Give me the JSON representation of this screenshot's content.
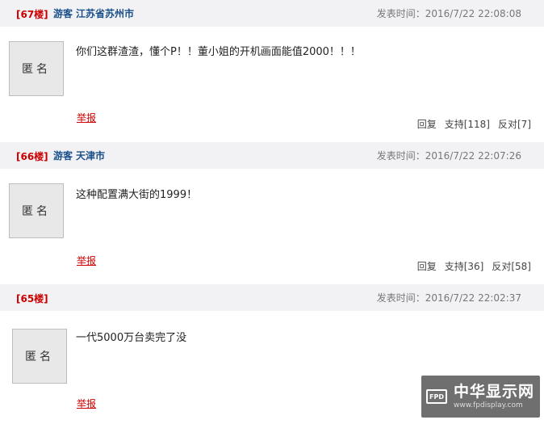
{
  "posts": [
    {
      "floor": "[67楼]",
      "user": "游客",
      "location": "江苏省苏州市",
      "time": "发表时间：2016/7/22 22:08:08",
      "avatar": "匿名",
      "content": "你们这群渣渣，懂个P！！董小姐的开机画面能值2000！！！",
      "report": "举报",
      "reply": "回复",
      "support": "支持[118]",
      "oppose": "反对[7]"
    },
    {
      "floor": "[66楼]",
      "user": "游客",
      "location": "天津市",
      "time": "发表时间：2016/7/22 22:07:26",
      "avatar": "匿名",
      "content": "这种配置满大街的1999！",
      "report": "举报",
      "reply": "回复",
      "support": "支持[36]",
      "oppose": "反对[58]"
    },
    {
      "floor": "[65楼]",
      "time": "发表时间：2016/7/22 22:02:37",
      "avatar": "匿名",
      "content": "一代5000万台卖完了没",
      "report": "举报"
    }
  ],
  "watermark": {
    "logo": "FPD",
    "name": "中华显示网",
    "url": "www.fpdisplay.com"
  },
  "colors": {
    "floor": "#cc0000",
    "user": "#1a4f8a",
    "header_bg": "#f2f2f5",
    "report": "#cc0000"
  }
}
